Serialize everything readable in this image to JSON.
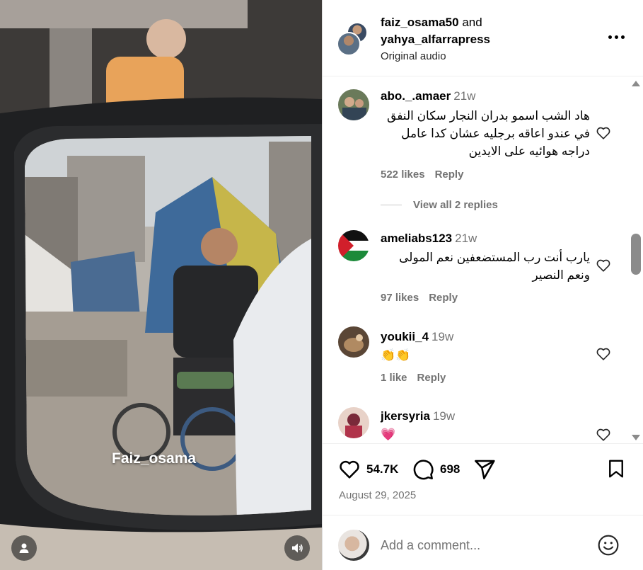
{
  "media": {
    "overlay_text": "Faiz_osama"
  },
  "header": {
    "user1": "faiz_osama50",
    "connector": "and",
    "user2": "yahya_alfarrapress",
    "audio": "Original audio"
  },
  "comments": [
    {
      "user": "abo._.amaer",
      "time": "21w",
      "text": "هاد الشب اسمو بدران النجار سكان النفق في عندو اعاقه برجليه عشان كدا عامل دراجه هوائيه على الايدين",
      "likes": "522 likes",
      "reply": "Reply",
      "view_replies": "View all 2 replies"
    },
    {
      "user": "ameliabs123",
      "time": "21w",
      "text": "يارب أنت رب المستضعفين نعم المولى ونعم النصير",
      "likes": "97 likes",
      "reply": "Reply"
    },
    {
      "user": "youkii_4",
      "time": "19w",
      "text": "👏👏",
      "likes": "1 like",
      "reply": "Reply"
    },
    {
      "user": "jkersyria",
      "time": "19w",
      "text": "💗",
      "likes": "",
      "reply": ""
    }
  ],
  "actions": {
    "likes": "54.7K",
    "comments": "698",
    "date": "August 29, 2025"
  },
  "composer": {
    "placeholder": "Add a comment..."
  },
  "icons": {
    "more": "more-dots-icon",
    "like": "heart-icon",
    "comment": "comment-bubble-icon",
    "share": "paper-plane-icon",
    "save": "bookmark-icon",
    "emoji": "smiley-icon",
    "tag": "user-tag-icon",
    "mute": "speaker-icon"
  }
}
